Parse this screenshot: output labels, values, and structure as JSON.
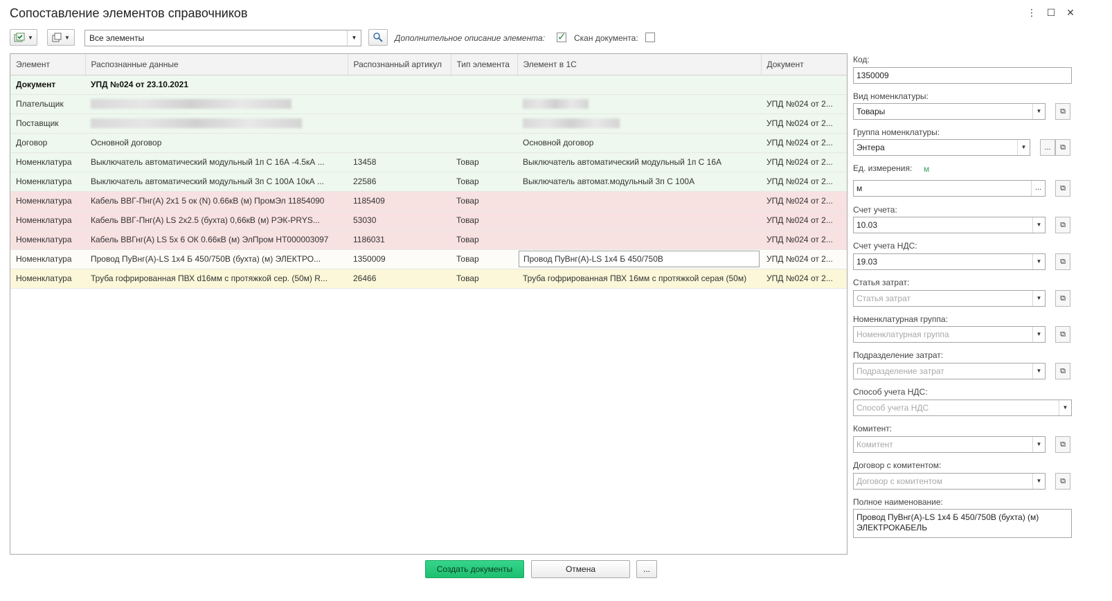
{
  "window": {
    "title": "Сопоставление элементов справочников",
    "controls": [
      "⋮",
      "☐",
      "✕"
    ]
  },
  "toolbar": {
    "filter_value": "Все элементы",
    "extra_desc_label": "Дополнительное описание элемента:",
    "extra_desc_checked": true,
    "scan_label": "Скан документа:",
    "scan_checked": false
  },
  "grid": {
    "columns": [
      "Элемент",
      "Распознанные данные",
      "Распознанный артикул",
      "Тип элемента",
      "Элемент в 1С",
      "Документ"
    ],
    "rows": [
      {
        "state": "header-row",
        "element": "Документ",
        "recognized": "УПД №024 от 23.10.2021",
        "article": "",
        "type": "",
        "in1c": "",
        "doc": ""
      },
      {
        "state": "green",
        "element": "Плательщик",
        "recognized": "",
        "article": "",
        "type": "",
        "in1c": "",
        "doc": "УПД №024 от 2..."
      },
      {
        "state": "green",
        "element": "Поставщик",
        "recognized": "",
        "article": "",
        "type": "",
        "in1c": "",
        "doc": "УПД №024 от 2..."
      },
      {
        "state": "green",
        "element": "Договор",
        "recognized": "Основной договор",
        "article": "",
        "type": "",
        "in1c": "Основной договор",
        "doc": "УПД №024 от 2..."
      },
      {
        "state": "green",
        "element": "Номенклатура",
        "recognized": "Выключатель автоматический модульный 1п C 16А -4.5кА ...",
        "article": "13458",
        "type": "Товар",
        "in1c": "Выключатель автоматический модульный 1п C 16А",
        "doc": "УПД №024 от 2..."
      },
      {
        "state": "green",
        "element": "Номенклатура",
        "recognized": "Выключатель автоматический модульный 3п C 100А 10кА ...",
        "article": "22586",
        "type": "Товар",
        "in1c": "Выключатель автомат.модульный 3п C 100А",
        "doc": "УПД №024 от 2..."
      },
      {
        "state": "red",
        "element": "Номенклатура",
        "recognized": "Кабель ВВГ-Пнг(А) 2х1 5 ок (N) 0.66кВ (м) ПромЭл 11854090",
        "article": "1185409",
        "type": "Товар",
        "in1c": "",
        "doc": "УПД №024 от 2..."
      },
      {
        "state": "red",
        "element": "Номенклатура",
        "recognized": "Кабель ВВГ-Пнг(А) LS 2х2.5 (бухта) 0,66кВ (м) РЭК-PRYS...",
        "article": "53030",
        "type": "Товар",
        "in1c": "",
        "doc": "УПД №024 от 2..."
      },
      {
        "state": "red",
        "element": "Номенклатура",
        "recognized": "Кабель ВВГнг(А) LS 5х 6 ОК 0.66кВ (м) ЭлПром НТ000003097",
        "article": "1186031",
        "type": "Товар",
        "in1c": "",
        "doc": "УПД №024 от 2..."
      },
      {
        "state": "selected",
        "element": "Номенклатура",
        "recognized": "Провод ПуВнг(А)-LS 1х4 Б 450/750В (бухта) (м) ЭЛЕКТРО...",
        "article": "1350009",
        "type": "Товар",
        "in1c": "Провод ПуВнг(А)-LS 1х4 Б 450/750В",
        "doc": "УПД №024 от 2..."
      },
      {
        "state": "yellow",
        "element": "Номенклатура",
        "recognized": "Труба гофрированная ПВХ d16мм с протяжкой сер. (50м) R...",
        "article": "26466",
        "type": "Товар",
        "in1c": "Труба гофрированная ПВХ 16мм с протяжкой серая (50м)",
        "doc": "УПД №024 от 2..."
      }
    ]
  },
  "panel": {
    "kod_label": "Код:",
    "kod_value": "1350009",
    "vid_label": "Вид номенклатуры:",
    "vid_value": "Товары",
    "group_label": "Группа номенклатуры:",
    "group_value": "Энтера",
    "unit_label": "Ед. измерения:",
    "unit_hint": "м",
    "unit_value": "м",
    "account_label": "Счет учета:",
    "account_value": "10.03",
    "vat_account_label": "Счет учета НДС:",
    "vat_account_value": "19.03",
    "cost_item_label": "Статья затрат:",
    "cost_item_placeholder": "Статья затрат",
    "nom_group_label": "Номенклатурная группа:",
    "nom_group_placeholder": "Номенклатурная группа",
    "cost_dept_label": "Подразделение затрат:",
    "cost_dept_placeholder": "Подразделение затрат",
    "vat_method_label": "Способ учета НДС:",
    "vat_method_placeholder": "Способ учета НДС",
    "committent_label": "Комитент:",
    "committent_placeholder": "Комитент",
    "committent_contract_label": "Договор с комитентом:",
    "committent_contract_placeholder": "Договор с комитентом",
    "full_name_label": "Полное наименование:",
    "full_name_value": "Провод ПуВнг(А)-LS 1х4 Б 450/750В (бухта) (м) ЭЛЕКТРОКАБЕЛЬ"
  },
  "footer": {
    "create_label": "Создать документы",
    "cancel_label": "Отмена",
    "more_label": "..."
  }
}
